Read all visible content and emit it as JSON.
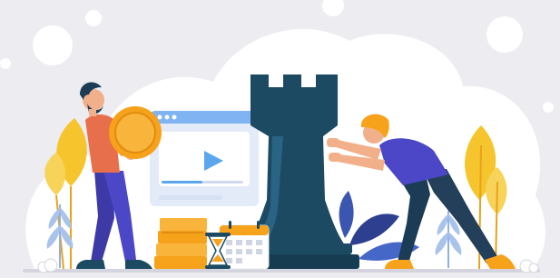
{
  "illustration": {
    "subject": "strategy-business-illustration",
    "icons": [
      "gold-coin",
      "video-play",
      "chess-rook",
      "calendar",
      "hourglass",
      "coin-stack"
    ],
    "colors": {
      "background": "#ececf1",
      "cloud": "#ffffff",
      "rook": "#1c4a63",
      "accent_orange": "#f7a21b",
      "player_blue": "#5aa7ee",
      "shirt_left": "#e86f4b",
      "shirt_right": "#4b47c7",
      "pants": "#4b47c7",
      "plant_yellow": "#f6c52d",
      "plant_blue": "#a9c3ea"
    }
  }
}
